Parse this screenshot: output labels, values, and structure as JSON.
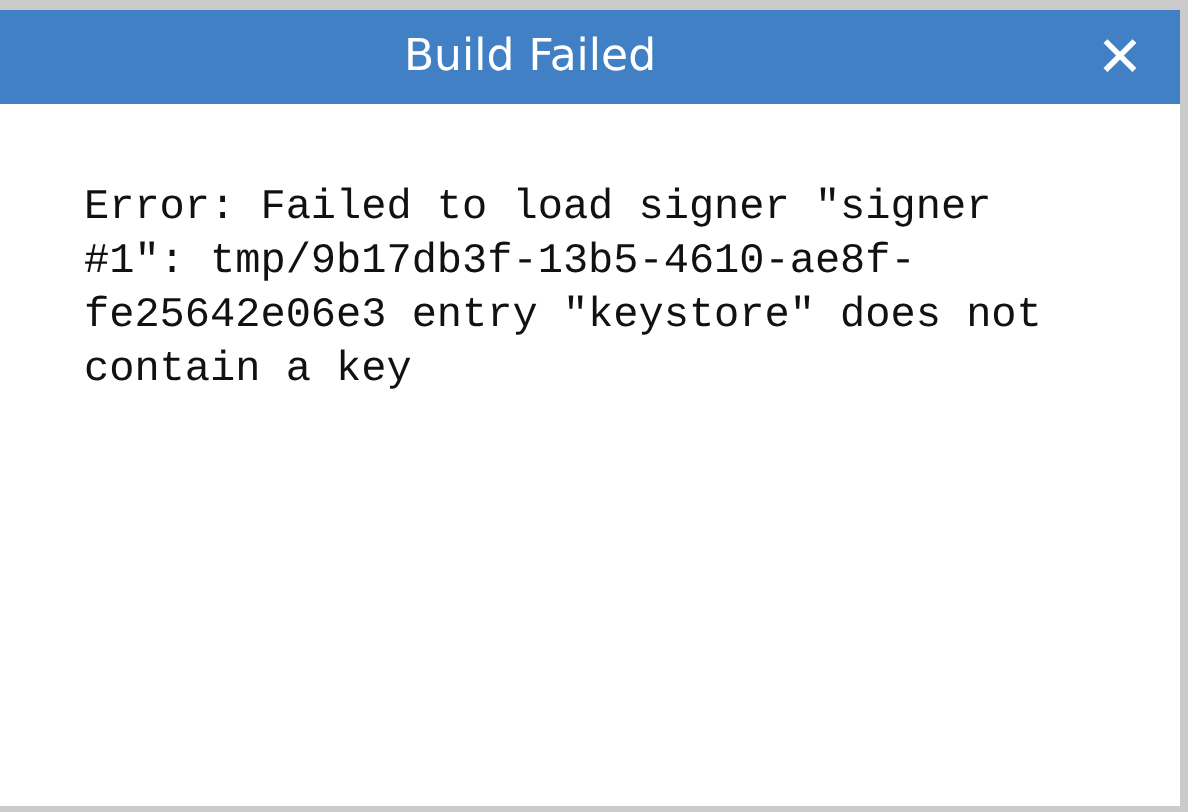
{
  "dialog": {
    "title": "Build Failed",
    "close_label": "✕",
    "message": "Error: Failed to load signer \"signer #1\": tmp/9b17db3f-13b5-4610-ae8f-fe25642e06e3 entry \"keystore\" does not contain a key"
  }
}
